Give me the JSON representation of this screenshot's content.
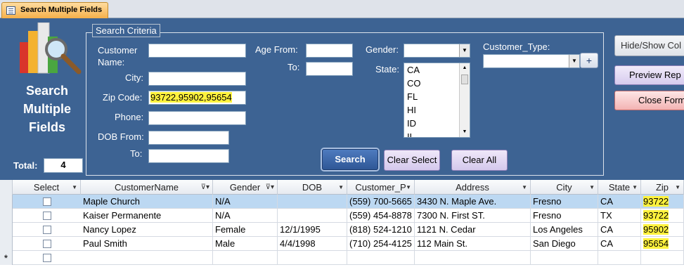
{
  "tab": {
    "title": "Search Multiple Fields"
  },
  "form": {
    "title": "Search Multiple Fields",
    "total_label": "Total:",
    "total_value": "4",
    "criteria_legend": "Search Criteria",
    "labels": {
      "customer_name": "Customer Name:",
      "city": "City:",
      "zip": "Zip Code:",
      "phone": "Phone:",
      "dob_from": "DOB From:",
      "dob_to": "To:",
      "age_from": "Age From:",
      "age_to": "To:",
      "gender": "Gender:",
      "state": "State:",
      "customer_type": "Customer_Type:"
    },
    "values": {
      "customer_name": "",
      "city": "",
      "zip": "93722,95902,95654",
      "phone": "",
      "dob_from": "",
      "dob_to": "",
      "age_from": "",
      "age_to": "",
      "gender": "",
      "customer_type": ""
    },
    "state_options": [
      "CA",
      "CO",
      "FL",
      "HI",
      "ID",
      "IL"
    ],
    "buttons": {
      "search": "Search",
      "clear_select": "Clear Select",
      "clear_all": "Clear All",
      "hide_show": "Hide/Show Col",
      "preview": "Preview Rep",
      "close": "Close Form",
      "add": "+"
    }
  },
  "grid": {
    "columns": [
      "Select",
      "CustomerName",
      "Gender",
      "DOB",
      "Customer_P",
      "Address",
      "City",
      "State",
      "Zip"
    ],
    "rows": [
      {
        "name": "Maple Church",
        "gender": "N/A",
        "dob": "",
        "phone": "(559) 700-5665",
        "address": "3430 N. Maple Ave.",
        "city": "Fresno",
        "state": "CA",
        "zip": "93722"
      },
      {
        "name": "Kaiser Permanente",
        "gender": "N/A",
        "dob": "",
        "phone": "(559) 454-8878",
        "address": "7300 N. First ST.",
        "city": "Fresno",
        "state": "TX",
        "zip": "93722"
      },
      {
        "name": "Nancy Lopez",
        "gender": "Female",
        "dob": "12/1/1995",
        "phone": "(818) 524-1210",
        "address": "1121 N. Cedar",
        "city": "Los Angeles",
        "state": "CA",
        "zip": "95902"
      },
      {
        "name": "Paul Smith",
        "gender": "Male",
        "dob": "4/4/1998",
        "phone": "(710) 254-4125",
        "address": "112 Main St.",
        "city": "San Diego",
        "state": "CA",
        "zip": "95654"
      }
    ],
    "new_record_marker": "*"
  },
  "colors": {
    "header_bg": "#3d6393",
    "highlight": "#fff23d",
    "selected_row": "#bcd8f2"
  }
}
